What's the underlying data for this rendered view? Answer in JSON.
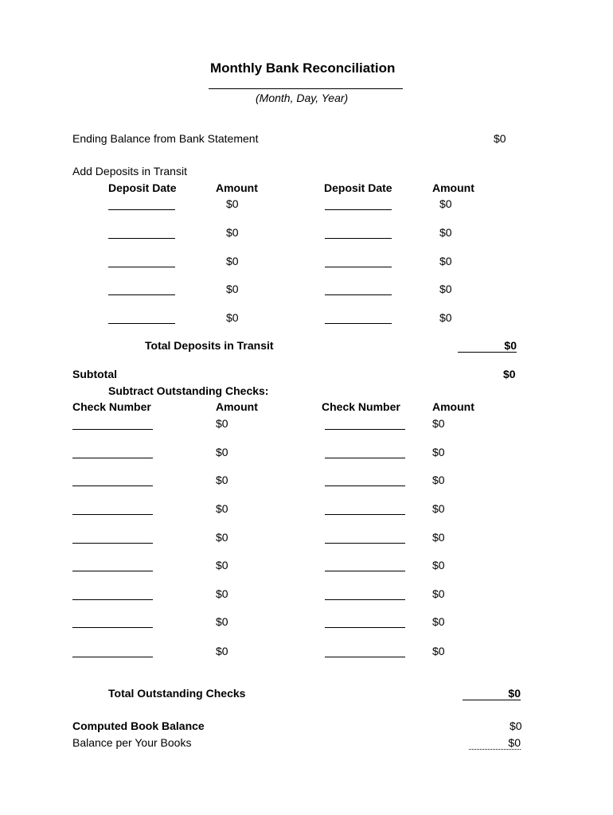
{
  "title": "Monthly Bank Reconciliation",
  "date_caption": "(Month, Day, Year)",
  "ending_balance": {
    "label": "Ending Balance from Bank Statement",
    "value": "$0"
  },
  "deposits": {
    "heading": "Add Deposits in Transit",
    "col_date": "Deposit Date",
    "col_amount": "Amount",
    "left_amounts": [
      "$0",
      "$0",
      "$0",
      "$0",
      "$0"
    ],
    "right_amounts": [
      "$0",
      "$0",
      "$0",
      "$0",
      "$0"
    ],
    "total_label": "Total Deposits in Transit",
    "total_value": "$0"
  },
  "subtotal": {
    "label": "Subtotal",
    "value": "$0"
  },
  "checks": {
    "heading": "Subtract Outstanding Checks:",
    "col_number": "Check Number",
    "col_amount": "Amount",
    "left_amounts": [
      "$0",
      "$0",
      "$0",
      "$0",
      "$0",
      "$0",
      "$0",
      "$0",
      "$0"
    ],
    "right_amounts": [
      "$0",
      "$0",
      "$0",
      "$0",
      "$0",
      "$0",
      "$0",
      "$0",
      "$0"
    ],
    "total_label": "Total Outstanding Checks",
    "total_value": "$0"
  },
  "computed_book_balance": {
    "label": "Computed Book Balance",
    "value": "$0"
  },
  "balance_per_books": {
    "label": "Balance per Your Books",
    "value": "$0"
  }
}
